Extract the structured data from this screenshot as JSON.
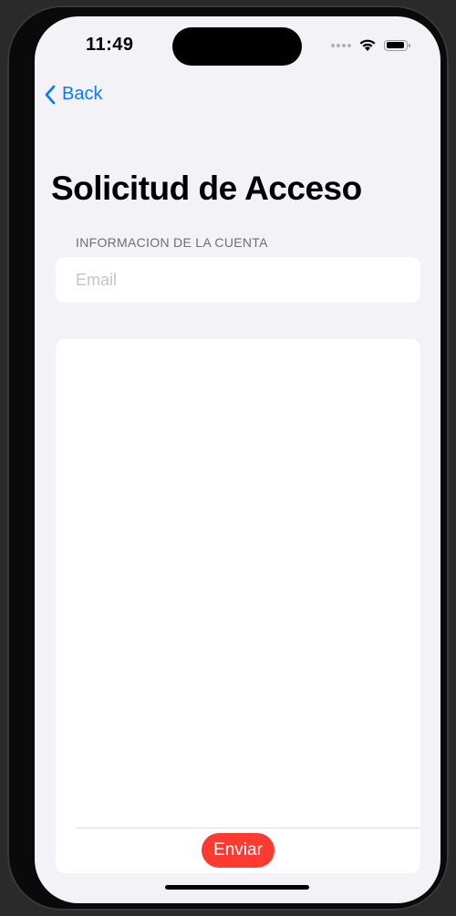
{
  "status_bar": {
    "time": "11:49",
    "icons": [
      "signal-dots-icon",
      "wifi-icon",
      "battery-icon"
    ]
  },
  "nav": {
    "back_label": "Back"
  },
  "page": {
    "title": "Solicitud de Acceso"
  },
  "account_section": {
    "header": "INFORMACION DE LA CUENTA",
    "email_placeholder": "Email",
    "email_value": ""
  },
  "message_section": {
    "message_value": ""
  },
  "actions": {
    "send_label": "Enviar"
  },
  "colors": {
    "accent": "#0a7bff",
    "send_button": "#ff3b30",
    "background": "#f2f2f7",
    "card": "#ffffff"
  }
}
